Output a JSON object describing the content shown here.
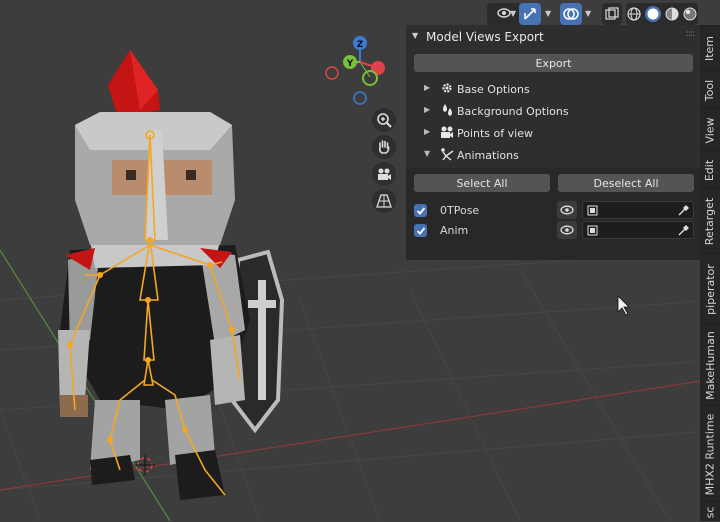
{
  "colors": {
    "accent": "#4772b3",
    "panel_bg": "#2e2e2e",
    "button": "#545454",
    "viewport": "#3d3d3d"
  },
  "header": {
    "icons": [
      "visibility-icon",
      "gizmo-icon",
      "overlay-icon",
      "xray-icon",
      "wireframe-shading-icon",
      "solid-shading-icon",
      "material-shading-icon",
      "rendered-shading-icon"
    ]
  },
  "gizmo": {
    "z": "Z",
    "y": "Y"
  },
  "panel": {
    "title": "Model Views Export",
    "export_label": "Export",
    "subpanels": [
      {
        "label": "Base Options",
        "expanded": false,
        "icon": "gear-icon"
      },
      {
        "label": "Background Options",
        "expanded": false,
        "icon": "color-drops-icon"
      },
      {
        "label": "Points of view",
        "expanded": false,
        "icon": "camera-icon"
      },
      {
        "label": "Animations",
        "expanded": true,
        "icon": "armature-icon"
      }
    ],
    "select_all_label": "Select All",
    "deselect_all_label": "Deselect All",
    "actions": [
      {
        "name": "0TPose",
        "checked": true
      },
      {
        "name": "Anim",
        "checked": true
      }
    ]
  },
  "tabs": [
    "Item",
    "Tool",
    "View",
    "Edit",
    "Retarget",
    "piperator",
    "MakeHuman",
    "MHX2 Runtime",
    "sc"
  ]
}
